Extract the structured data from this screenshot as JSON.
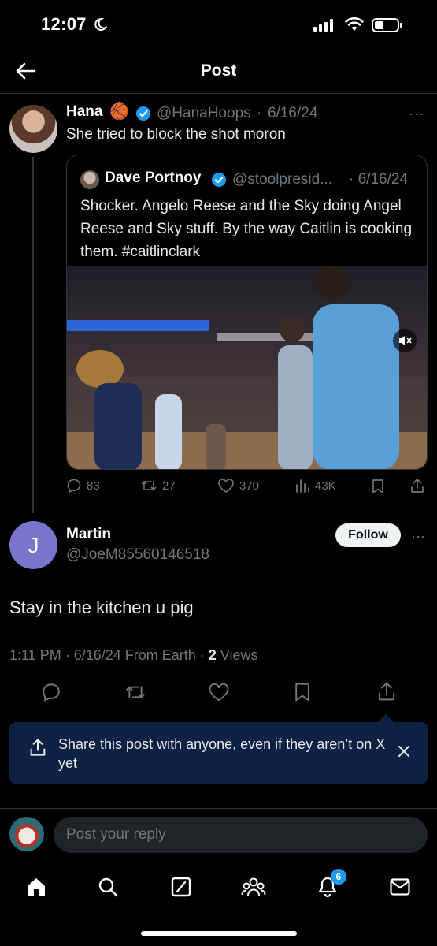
{
  "status_bar": {
    "time": "12:07"
  },
  "header": {
    "title": "Post"
  },
  "parent_post": {
    "name": "Hana",
    "emoji": "🏀",
    "handle": "@HanaHoops",
    "dot": "·",
    "date": "6/16/24",
    "text": "She tried to block the shot moron",
    "more": "···"
  },
  "quoted_post": {
    "name": "Dave Portnoy",
    "handle": "@stoolpresid...",
    "date": "· 6/16/24",
    "text": "Shocker.   Angelo Reese and the Sky doing Angel Reese and Sky stuff.    By the way Caitlin is cooking them.  #caitlinclark"
  },
  "parent_actions": {
    "replies": "83",
    "reposts": "27",
    "likes": "370",
    "views": "43K"
  },
  "reply": {
    "avatar_letter": "J",
    "name": "Martin",
    "handle": "@JoeM85560146518",
    "follow_label": "Follow",
    "more": "···",
    "text": "Stay in the kitchen u pig",
    "meta_prefix": "1:11 PM · 6/16/24 From Earth · ",
    "views_count": "2",
    "views_label": " Views"
  },
  "share_tip": {
    "text": "Share this post with anyone, even if they aren’t on X yet"
  },
  "reply_bar": {
    "placeholder": "Post your reply"
  },
  "tab_bar": {
    "notification_count": "6"
  },
  "colors": {
    "accent": "#1d9bf0",
    "muted": "#71767b",
    "tip_bg": "#0d2145"
  }
}
